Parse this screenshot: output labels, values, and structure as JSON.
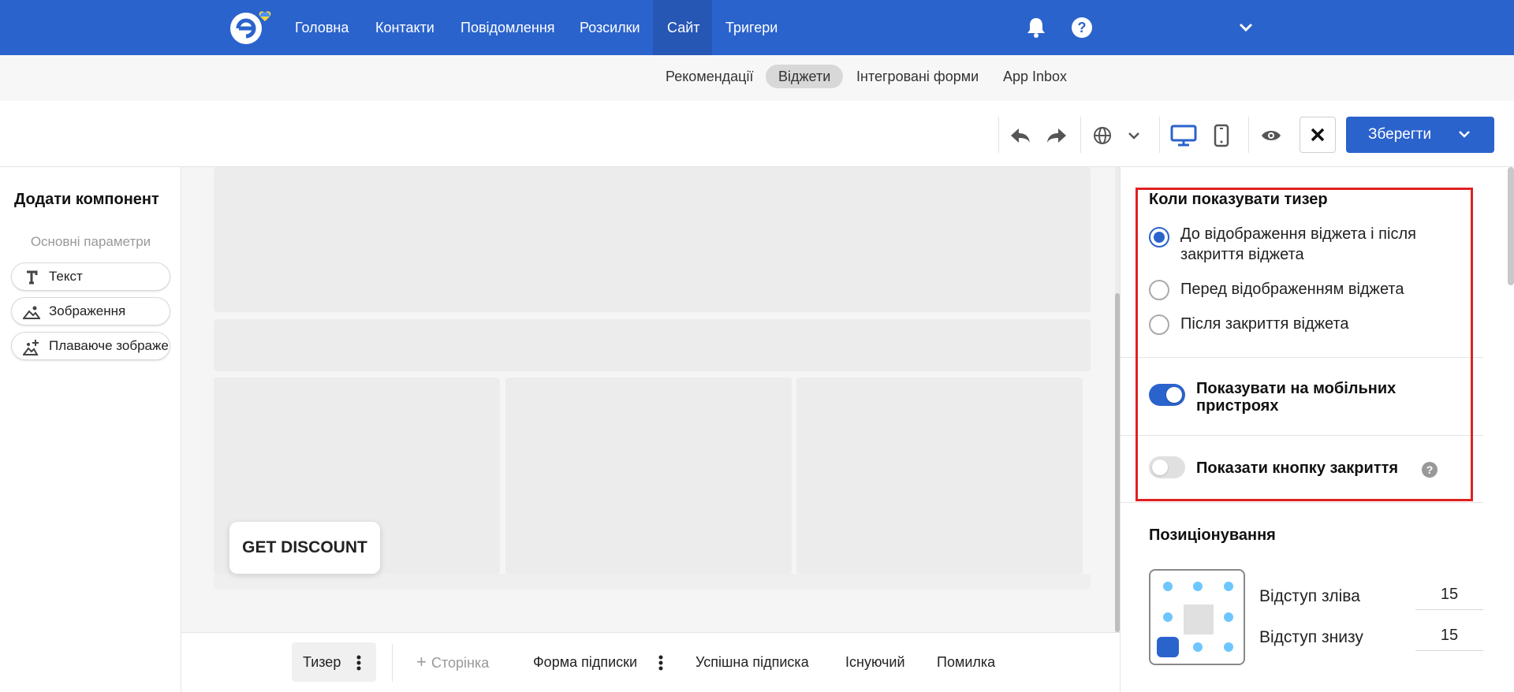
{
  "nav": {
    "items": [
      {
        "label": "Головна"
      },
      {
        "label": "Контакти"
      },
      {
        "label": "Повідомлення"
      },
      {
        "label": "Розсилки"
      },
      {
        "label": "Сайт"
      },
      {
        "label": "Тригери"
      }
    ],
    "active": "Сайт",
    "icons": [
      "logo-icon",
      "bell-icon",
      "help-icon",
      "chevron-down-icon"
    ]
  },
  "subnav": {
    "items": [
      {
        "label": "Рекомендації"
      },
      {
        "label": "Віджети"
      },
      {
        "label": "Інтегровані форми"
      },
      {
        "label": "App Inbox"
      }
    ],
    "active": "Віджети"
  },
  "toolbar": {
    "icons": [
      "undo-icon",
      "redo-icon",
      "globe-icon",
      "chevron-down-icon",
      "desktop-icon",
      "mobile-icon",
      "preview-eye-icon",
      "close-icon"
    ],
    "save_label": "Зберегти"
  },
  "sidebar": {
    "title": "Додати компонент",
    "section": "Основні параметри",
    "components": [
      {
        "label": "Текст",
        "icon": "text-icon"
      },
      {
        "label": "Зображення",
        "icon": "image-icon"
      },
      {
        "label": "Плаваюче зображення",
        "icon": "floating-image-icon"
      }
    ]
  },
  "canvas": {
    "teaser_label": "GET DISCOUNT"
  },
  "bottom_tabs": {
    "teaser": "Тизер",
    "add_page": "Сторінка",
    "subscribe_form": "Форма підписки",
    "success": "Успішна підписка",
    "existing": "Існуючий",
    "error": "Помилка"
  },
  "panel": {
    "teaser_title": "Коли показувати тизер",
    "radio_options": [
      {
        "label": "До відображення віджета і після закриття віджета",
        "checked": true
      },
      {
        "label": "Перед відображенням віджета",
        "checked": false
      },
      {
        "label": "Після закриття віджета",
        "checked": false
      }
    ],
    "show_mobile": {
      "label": "Показувати на мобільних пристроях",
      "on": true
    },
    "show_close": {
      "label": "Показати кнопку закриття",
      "on": false,
      "help": "?"
    },
    "positioning": {
      "title": "Позиціонування",
      "offset_left_label": "Відступ зліва",
      "offset_left_value": "15",
      "offset_bottom_label": "Відступ знизу",
      "offset_bottom_value": "15",
      "selected_anchor": "bottom-left"
    }
  },
  "colors": {
    "brand": "#2b63cc",
    "highlight": "#e02020",
    "anchor_dot": "#6ec6ff"
  }
}
